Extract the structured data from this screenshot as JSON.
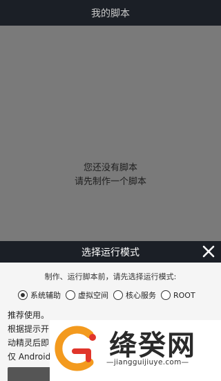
{
  "titlebar": {
    "title": "我的脚本"
  },
  "empty_state": {
    "line1": "您还没有脚本",
    "line2": "请先制作一个脚本"
  },
  "sheet": {
    "title": "选择运行模式",
    "prompt": "制作、运行脚本前，请先选择运行模式:",
    "modes": [
      {
        "label": "系统辅助",
        "selected": true
      },
      {
        "label": "虚拟空间",
        "selected": false
      },
      {
        "label": "核心服务",
        "selected": false
      },
      {
        "label": "ROOT",
        "selected": false
      }
    ],
    "description": [
      "推荐使用。",
      "根据提示开",
      "动精灵后即",
      "仅 Android"
    ]
  },
  "watermark": {
    "title": "绛癸网",
    "url": "jiangguijiuye.com"
  },
  "colors": {
    "bar": "#1b1f26",
    "background": "#7a7a7a",
    "sheet": "#f5f5f5",
    "logo_orange": "#f39a1e",
    "logo_red": "#e0352b"
  },
  "icons": {
    "close": "close-icon",
    "radio": "radio-icon"
  }
}
